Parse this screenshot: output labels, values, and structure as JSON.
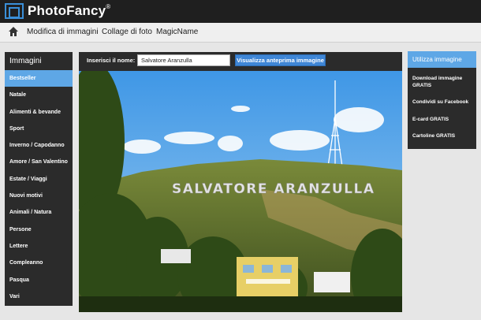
{
  "app": {
    "name": "PhotoFancy",
    "registered_mark": "®"
  },
  "nav": {
    "home_icon": "home-icon",
    "items": [
      {
        "label": "Modifica di immagini"
      },
      {
        "label": "Collage di foto"
      },
      {
        "label": "MagicName"
      }
    ]
  },
  "sidebar": {
    "title": "Immagini",
    "items": [
      {
        "label": "Bestseller",
        "active": true
      },
      {
        "label": "Natale"
      },
      {
        "label": "Alimenti & bevande"
      },
      {
        "label": "Sport"
      },
      {
        "label": "Inverno / Capodanno"
      },
      {
        "label": "Amore / San Valentino"
      },
      {
        "label": "Estate / Viaggi"
      },
      {
        "label": "Nuovi motivi"
      },
      {
        "label": "Animali / Natura"
      },
      {
        "label": "Persone"
      },
      {
        "label": "Lettere"
      },
      {
        "label": "Compleanno"
      },
      {
        "label": "Pasqua"
      },
      {
        "label": "Vari"
      }
    ]
  },
  "editor": {
    "name_label": "Inserisci il nome:",
    "name_value": "Salvatore Aranzulla",
    "preview_button": "Visualizza anteprima immagine",
    "sign_text": "SALVATORE ARANZULLA"
  },
  "actions": {
    "title": "Utilizza immagine",
    "items": [
      {
        "label": "Download immagine GRATIS"
      },
      {
        "label": "Condividi su Facebook"
      },
      {
        "label": "E-card GRATIS"
      },
      {
        "label": "Cartoline GRATIS"
      }
    ]
  },
  "colors": {
    "accent": "#5ea7e6",
    "button": "#3f86d6",
    "dark": "#2b2b2b",
    "topbar": "#1f1f1f"
  }
}
